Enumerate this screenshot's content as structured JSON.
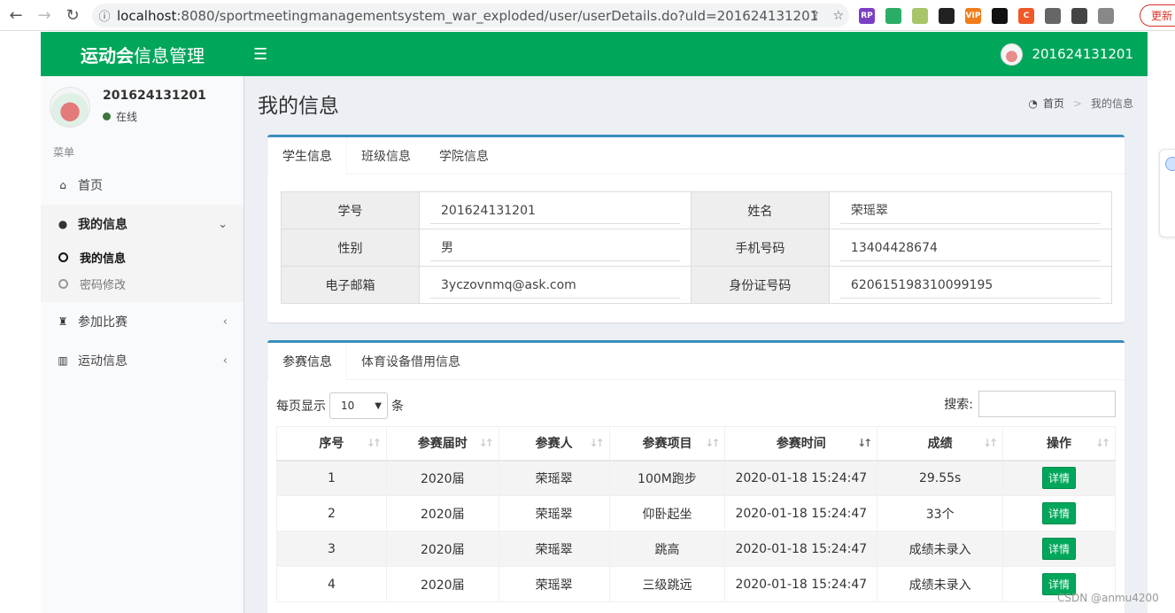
{
  "browser": {
    "url_host": "localhost",
    "url_rest": ":8080/sportmeetingmanagementsystem_war_exploded/user/userDetails.do?uId=201624131201",
    "update_label": "更新",
    "extensions": [
      {
        "name": "rp-extension-icon",
        "label": "RP",
        "color": "#7b3fc4"
      },
      {
        "name": "wechat-extension-icon",
        "label": "",
        "color": "#2aae67"
      },
      {
        "name": "image-extension-icon",
        "label": "",
        "color": "#a8c56a"
      },
      {
        "name": "game-extension-icon",
        "label": "",
        "color": "#222222"
      },
      {
        "name": "vip-extension-icon",
        "label": "VIP",
        "color": "#f07d1a"
      },
      {
        "name": "glasses-extension-icon",
        "label": "",
        "color": "#111111"
      },
      {
        "name": "c-extension-icon",
        "label": "C",
        "color": "#f05a28"
      },
      {
        "name": "puzzle-extension-icon",
        "label": "",
        "color": "#666666"
      },
      {
        "name": "sidepanel-icon",
        "label": "",
        "color": "#444444"
      },
      {
        "name": "profile-icon",
        "label": "",
        "color": "#888888"
      }
    ]
  },
  "header": {
    "brand_bold": "运动会",
    "brand_rest": "信息管理",
    "username": "201624131201",
    "color": "#00a65a"
  },
  "sidebar": {
    "username": "201624131201",
    "status": "在线",
    "menu_header": "菜单",
    "items": [
      {
        "label": "首页"
      },
      {
        "label": "我的信息"
      },
      {
        "label": "参加比赛"
      },
      {
        "label": "运动信息"
      }
    ],
    "submenu": [
      {
        "label": "我的信息"
      },
      {
        "label": "密码修改"
      }
    ]
  },
  "page": {
    "title": "我的信息",
    "breadcrumb_home": "首页",
    "breadcrumb_current": "我的信息"
  },
  "info_box": {
    "tabs": [
      "学生信息",
      "班级信息",
      "学院信息"
    ],
    "rows": [
      {
        "l1": "学号",
        "v1": "201624131201",
        "l2": "姓名",
        "v2": "荣瑶翠"
      },
      {
        "l1": "性别",
        "v1": "男",
        "l2": "手机号码",
        "v2": "13404428674"
      },
      {
        "l1": "电子邮箱",
        "v1": "3yczovnmq@ask.com",
        "l2": "身份证号码",
        "v2": "620615198310099195"
      }
    ]
  },
  "matches_box": {
    "tabs": [
      "参赛信息",
      "体育设备借用信息"
    ],
    "length_prefix": "每页显示",
    "length_value": "10",
    "length_suffix": "条",
    "search_label": "搜索:",
    "columns": [
      "序号",
      "参赛届时",
      "参赛人",
      "参赛项目",
      "参赛时间",
      "成绩",
      "操作"
    ],
    "rows": [
      {
        "no": "1",
        "session": "2020届",
        "person": "荣瑶翠",
        "event": "100M跑步",
        "time": "2020-01-18 15:24:47",
        "score": "29.55s",
        "action": "详情"
      },
      {
        "no": "2",
        "session": "2020届",
        "person": "荣瑶翠",
        "event": "仰卧起坐",
        "time": "2020-01-18 15:24:47",
        "score": "33个",
        "action": "详情"
      },
      {
        "no": "3",
        "session": "2020届",
        "person": "荣瑶翠",
        "event": "跳高",
        "time": "2020-01-18 15:24:47",
        "score": "成绩未录入",
        "action": "详情"
      },
      {
        "no": "4",
        "session": "2020届",
        "person": "荣瑶翠",
        "event": "三级跳远",
        "time": "2020-01-18 15:24:47",
        "score": "成绩未录入",
        "action": "详情"
      }
    ]
  },
  "watermark": "CSDN @anmu4200"
}
